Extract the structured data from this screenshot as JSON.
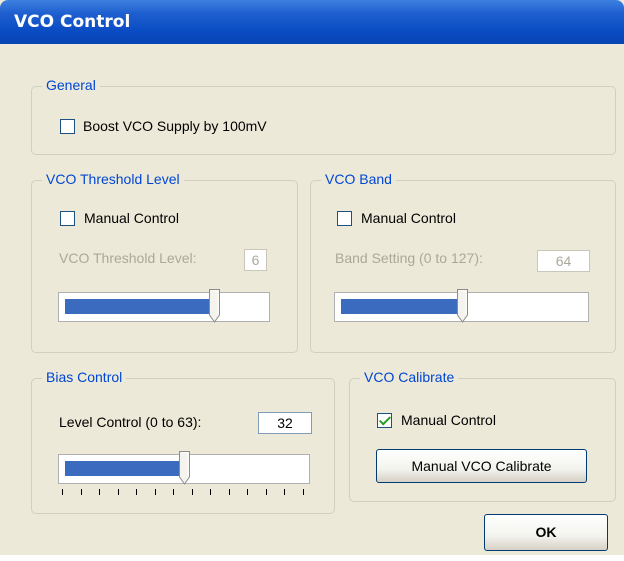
{
  "window": {
    "title": "VCO Control"
  },
  "general": {
    "legend": "General",
    "boost": {
      "label": "Boost VCO Supply by 100mV",
      "checked": false
    }
  },
  "threshold": {
    "legend": "VCO Threshold Level",
    "manual": {
      "label": "Manual Control",
      "checked": false
    },
    "level_label": "VCO Threshold Level:",
    "level_value": "6",
    "slider_fraction": 0.75
  },
  "band": {
    "legend": "VCO Band",
    "manual": {
      "label": "Manual Control",
      "checked": false
    },
    "setting_label": "Band Setting (0 to 127):",
    "setting_value": "64",
    "slider_fraction": 0.5
  },
  "bias": {
    "legend": "Bias Control",
    "level_label": "Level Control (0 to 63):",
    "level_value": "32",
    "slider_fraction": 0.5
  },
  "calibrate": {
    "legend": "VCO Calibrate",
    "manual": {
      "label": "Manual Control",
      "checked": true
    },
    "button_label": "Manual VCO Calibrate"
  },
  "ok_label": "OK",
  "colors": {
    "titlebar": "#0a4cc3",
    "legend": "#0046d5",
    "slider_fill": "#3a6bbf",
    "face": "#ece9d8"
  }
}
